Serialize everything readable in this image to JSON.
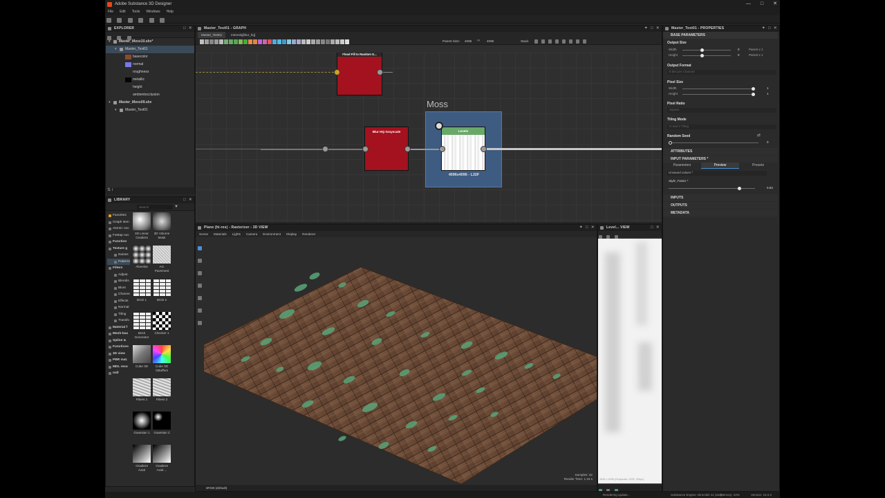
{
  "app": {
    "title": "Adobe Substance 3D Designer",
    "menu": [
      "File",
      "Edit",
      "Tools",
      "Windows",
      "Help"
    ]
  },
  "explorer": {
    "title": "EXPLORER",
    "items": [
      {
        "label": "Master_Moss10.sbs*",
        "indent": 0,
        "type": "package"
      },
      {
        "label": "Master_Test01",
        "indent": 1,
        "type": "graph",
        "selected": true
      },
      {
        "label": "basecolor",
        "indent": 2,
        "swatch": "#8a4a32"
      },
      {
        "label": "normal",
        "indent": 2,
        "swatch": "#7878e6"
      },
      {
        "label": "roughness",
        "indent": 2,
        "swatch": ""
      },
      {
        "label": "metallic",
        "indent": 2,
        "swatch": "#050505"
      },
      {
        "label": "height",
        "indent": 2,
        "swatch": ""
      },
      {
        "label": "ambientocclusion",
        "indent": 2,
        "swatch": ""
      },
      {
        "label": "Master_Moss09.sbs",
        "indent": 0,
        "type": "package"
      },
      {
        "label": "Master_Test01",
        "indent": 1,
        "type": "graph"
      }
    ]
  },
  "library": {
    "title": "LIBRARY",
    "search_placeholder": "Search",
    "tree": [
      "Favorites",
      "Graph item",
      "Atomic noc",
      "FxMap noc",
      "Function",
      "Texture g",
      "Noises",
      "Patterns",
      "Filters",
      "Adjust.",
      "Blendin",
      "Blurs",
      "Channe",
      "Effects",
      "Normal",
      "Tiling",
      "Transfo",
      "Material f",
      "Mesh-bas",
      "Spline &",
      "Functions",
      "3D view",
      "PBR mat.",
      "MDL reso",
      "mdl"
    ],
    "items": [
      {
        "label": "3D Linear Gradient",
        "thumb": "cube"
      },
      {
        "label": "3D Volume Mask",
        "thumb": "cube2"
      },
      {
        "label": "Alveolus",
        "thumb": "alveolus"
      },
      {
        "label": "Arc Pavement",
        "thumb": "arc"
      },
      {
        "label": "Brick 1",
        "thumb": "brick"
      },
      {
        "label": "Brick 2",
        "thumb": "brick"
      },
      {
        "label": "Brick Generator",
        "thumb": "brick"
      },
      {
        "label": "Checker 1",
        "thumb": "checker"
      },
      {
        "label": "Cube 3D",
        "thumb": "cube3d"
      },
      {
        "label": "Cube 3D GBuffers",
        "thumb": "rainbow"
      },
      {
        "label": "Fibers 1",
        "thumb": "fibers"
      },
      {
        "label": "Fibers 2",
        "thumb": "fibers"
      },
      {
        "label": "Gaussian 1",
        "thumb": "gauss1"
      },
      {
        "label": "Gaussian 2",
        "thumb": "gauss2"
      },
      {
        "label": "Gradient Axial",
        "thumb": "grad"
      },
      {
        "label": "Gradient Axial ...",
        "thumb": "grad"
      }
    ]
  },
  "graph": {
    "title": "Master_Test01 - GRAPH",
    "tabs": [
      "Master_Test01",
      "Intensity[blur_hq]"
    ],
    "parent_size_label": "Parent Size:",
    "parent_size": "4096",
    "parent_size2": "4096",
    "stack_label": "Stack",
    "frame_title": "Moss",
    "node_top_title": "Flood Fill to Random G...",
    "node_blur_title": "Blur HQ Grayscale",
    "node_levels_title": "Levels",
    "node_levels_res": "4096x4096 - L32F"
  },
  "view3d": {
    "title": "Plane (hi-res) - Rasterizer - 3D VIEW",
    "menu": [
      "Scene",
      "Materials",
      "Lights",
      "Camera",
      "Environment",
      "Display",
      "Renderer"
    ],
    "samples": "Samples: 32",
    "render_time": "Render Time: 1.19 s",
    "colorspace": "sRGB (default)"
  },
  "view2d": {
    "title": "Level... VIEW",
    "info": "4096 x 4096 (Grayscale, HDR, 32bpc)"
  },
  "properties": {
    "title": "Master_Test01 - PROPERTIES",
    "base_parameters": "BASE PARAMETERS",
    "output_size": "Output Size",
    "width_label": "Width",
    "height_label": "Height",
    "width_value": "0",
    "height_value": "0",
    "width_mode": "Parent x 1",
    "height_mode": "Parent x 1",
    "output_format": "Output Format",
    "output_format_value": "8 bits per Channel",
    "pixel_size": "Pixel Size",
    "px_width": "1",
    "px_height": "1",
    "pixel_ratio": "Pixel Ratio",
    "pixel_ratio_value": "Square",
    "tiling_mode": "Tiling Mode",
    "tiling_mode_value": "H and V Tiling",
    "random_seed": "Random Seed",
    "random_seed_value": "0",
    "attributes": "ATTRIBUTES",
    "input_parameters": "INPUT PARAMETERS *",
    "tabs": [
      "Parameters",
      "Preview",
      "Presets"
    ],
    "unsaved": "Unsaved values *",
    "style_factor_label": "Style_Factor *",
    "style_factor": "0.83",
    "inputs": "INPUTS",
    "outputs": "OUTPUTS",
    "metadata": "METADATA"
  },
  "status": {
    "left": "Rendering update...",
    "engine": "Substance Engine: Direct3D 11 (x64)",
    "memory": "Memory: 24%",
    "version": "Version: 15.0.2"
  },
  "colors": {
    "node_red": "#a3121e",
    "frame_blue": "#3e5c82",
    "levels_green": "#6aa86a",
    "accent": "#3b4a5a"
  }
}
